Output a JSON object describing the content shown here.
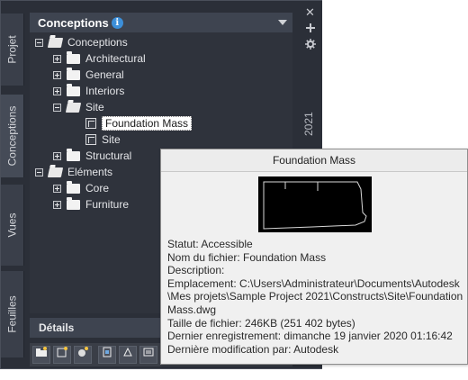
{
  "panel": {
    "title": "Conceptions",
    "details_label": "Détails"
  },
  "side_tabs": [
    "Projet",
    "Conceptions",
    "Vues",
    "Feuilles"
  ],
  "year_label": "2021",
  "tree": {
    "root": "Conceptions",
    "architectural": "Architectural",
    "general": "General",
    "interiors": "Interiors",
    "site": "Site",
    "foundation_mass": "Foundation Mass",
    "site_child": "Site",
    "structural": "Structural",
    "elements": "Eléments",
    "core": "Core",
    "furniture": "Furniture"
  },
  "tooltip": {
    "title": "Foundation Mass",
    "lines": [
      "Statut: Accessible",
      "Nom du fichier: Foundation Mass",
      "Description:",
      "Emplacement: C:\\Users\\Administrateur\\Documents\\Autodesk",
      "\\Mes projets\\Sample Project 2021\\Constructs\\Site\\Foundation",
      "Mass.dwg",
      "Taille de fichier: 246KB (251 402 bytes)",
      "Dernier enregistrement: dimanche 19 janvier 2020  01:16:42",
      "Dernière modification par: Autodesk"
    ]
  },
  "icons": {
    "info": "i",
    "close": "✕",
    "pin": "pin-icon",
    "settings": "gear-icon"
  },
  "colors": {
    "palette_bg": "#2b2f38",
    "header_bg": "#3e4450",
    "info_blue": "#3c8fd9",
    "tooltip_bg": "#f0f0f0"
  }
}
